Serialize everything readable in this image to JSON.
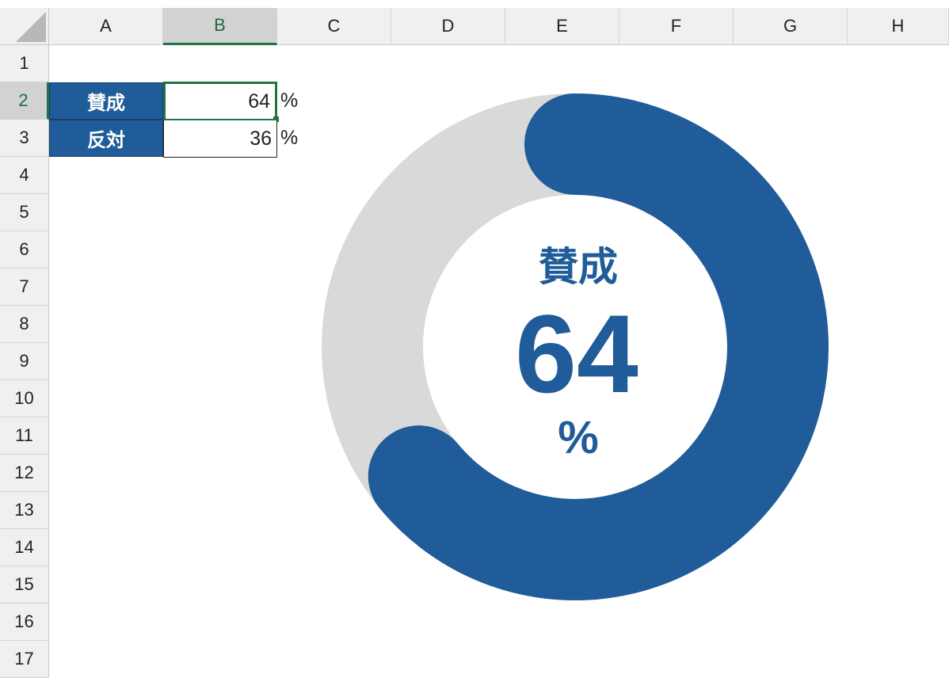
{
  "columns": [
    "A",
    "B",
    "C",
    "D",
    "E",
    "F",
    "G",
    "H"
  ],
  "rows": [
    "1",
    "2",
    "3",
    "4",
    "5",
    "6",
    "7",
    "8",
    "9",
    "10",
    "11",
    "12",
    "13",
    "14",
    "15",
    "16",
    "17"
  ],
  "table": [
    {
      "label": "賛成",
      "value": "64",
      "unit": "%"
    },
    {
      "label": "反対",
      "value": "36",
      "unit": "%"
    }
  ],
  "chart": {
    "title": "賛成",
    "value": "64",
    "unit": "%",
    "fraction": 0.64,
    "color": "#1f5c99",
    "track_color": "#d9d9d9"
  }
}
